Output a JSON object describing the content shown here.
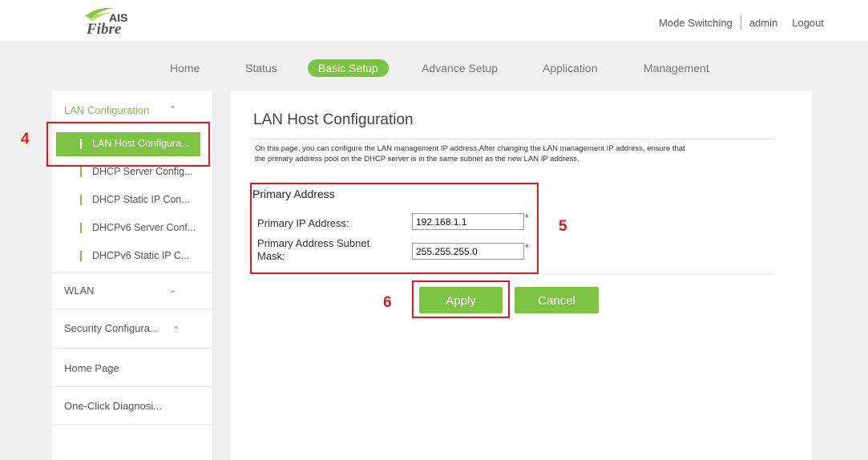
{
  "brand": {
    "logo_top": "AIS",
    "logo_bottom": "Fibre",
    "accent_color": "#7cc243"
  },
  "header": {
    "mode_switching": "Mode Switching",
    "user": "admin",
    "logout": "Logout"
  },
  "nav": {
    "items": [
      "Home",
      "Status",
      "Basic Setup",
      "Advance Setup",
      "Application",
      "Management"
    ],
    "active": "Basic Setup"
  },
  "sidebar": {
    "lan_group": {
      "label": "LAN Configuration",
      "chevron": "chevron-up-icon"
    },
    "lan_items": [
      "LAN Host Configura...",
      "DHCP Server Config...",
      "DHCP Static IP Con...",
      "DHCPv6 Server Conf...",
      "DHCPv6 Static IP C..."
    ],
    "active_item": "LAN Host Configura...",
    "groups": [
      {
        "label": "WLAN",
        "chevron": "chevron-down-icon"
      },
      {
        "label": "Security Configura...",
        "chevron": "chevron-down-icon"
      },
      {
        "label": "Home Page"
      },
      {
        "label": "One-Click Diagnosi..."
      }
    ]
  },
  "page": {
    "title": "LAN Host Configuration",
    "description_line1": "On this page, you can configure the LAN management IP address.After changing the LAN management IP address, ensure that",
    "description_line2": "the primary address pool on the DHCP server is in the same subnet as the new LAN IP address.",
    "section_title": "Primary Address",
    "ip_label": "Primary IP Address:",
    "ip_value": "192.168.1.1",
    "mask_label_line1": "Primary Address Subnet",
    "mask_label_line2": "Mask:",
    "mask_value": "255.255.255.0",
    "required_mark": "*",
    "apply_label": "Apply",
    "cancel_label": "Cancel"
  },
  "annotations": {
    "box4": "4",
    "box5": "5",
    "box6": "6",
    "color": "#e8151b"
  }
}
